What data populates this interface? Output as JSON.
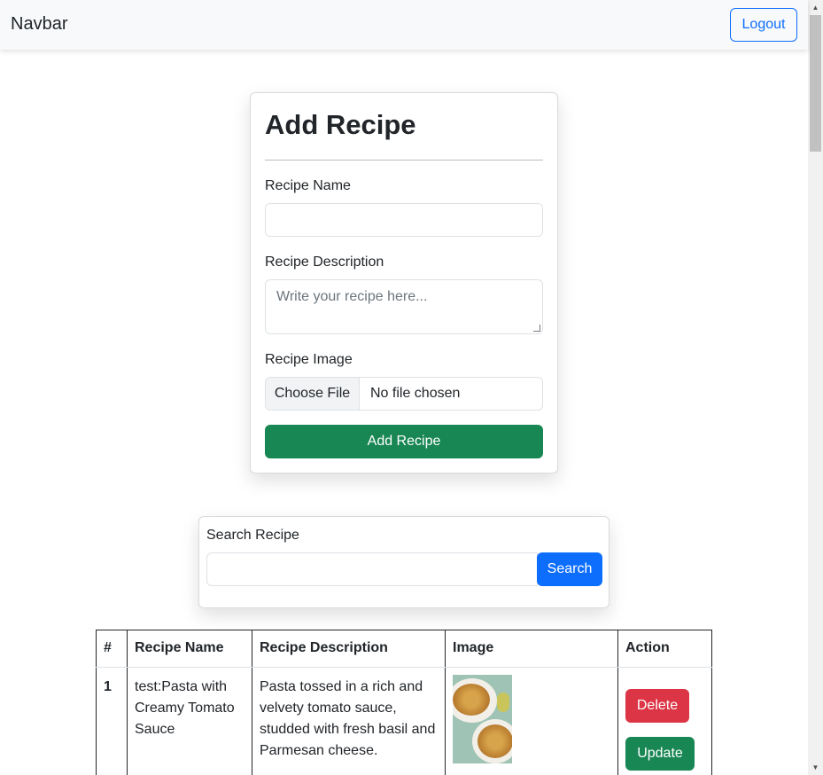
{
  "navbar": {
    "brand": "Navbar",
    "logout_label": "Logout"
  },
  "add_recipe": {
    "title": "Add Recipe",
    "name_label": "Recipe Name",
    "name_value": "",
    "description_label": "Recipe Description",
    "description_placeholder": "Write your recipe here...",
    "image_label": "Recipe Image",
    "file_button": "Choose File",
    "file_status": "No file chosen",
    "submit_label": "Add Recipe"
  },
  "search": {
    "label": "Search Recipe",
    "value": "",
    "button_label": "Search"
  },
  "table": {
    "headers": [
      "#",
      "Recipe Name",
      "Recipe Description",
      "Image",
      "Action"
    ],
    "rows": [
      {
        "number": "1",
        "name": "test:Pasta with Creamy Tomato Sauce",
        "description": "Pasta tossed in a rich and velvety tomato sauce, studded with fresh basil and Parmesan cheese.",
        "delete_label": "Delete",
        "update_label": "Update"
      }
    ]
  },
  "colors": {
    "primary": "#0d6efd",
    "success": "#198754",
    "danger": "#dc3545",
    "navbar_bg": "#f8f9fa"
  }
}
